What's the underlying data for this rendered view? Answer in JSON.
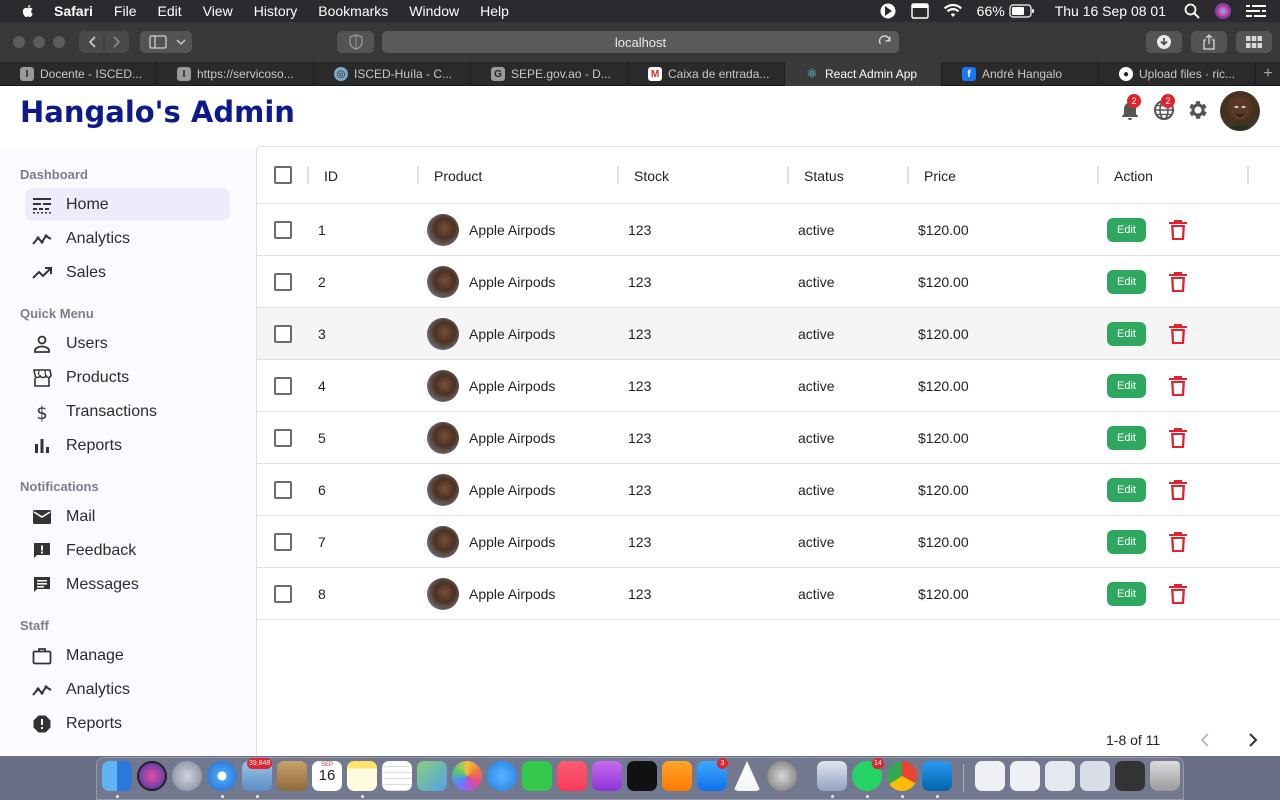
{
  "menubar": {
    "app_name": "Safari",
    "items": [
      "File",
      "Edit",
      "View",
      "History",
      "Bookmarks",
      "Window",
      "Help"
    ],
    "battery": "66%",
    "clock": "Thu 16 Sep  08 01"
  },
  "browser": {
    "url": "localhost",
    "tabs": [
      {
        "label": "Docente - ISCED...",
        "favicon": "I"
      },
      {
        "label": "https://servicoso...",
        "favicon": "I"
      },
      {
        "label": "ISCED-Huíla - C...",
        "favicon": "◎"
      },
      {
        "label": "SEPE.gov.ao - D...",
        "favicon": "G"
      },
      {
        "label": "Caixa de entrada...",
        "favicon": "M"
      },
      {
        "label": "React Admin App",
        "favicon": "⚛"
      },
      {
        "label": "André Hangalo",
        "favicon": "f"
      },
      {
        "label": "Upload files · ric...",
        "favicon": "●"
      }
    ],
    "active_tab": 5
  },
  "app": {
    "logo": "Hangalo's Admin",
    "notifications_count": "2",
    "language_count": "2"
  },
  "sidebar": {
    "sections": [
      {
        "title": "Dashboard",
        "items": [
          {
            "label": "Home",
            "icon": "line-style-icon",
            "active": true
          },
          {
            "label": "Analytics",
            "icon": "timeline-icon"
          },
          {
            "label": "Sales",
            "icon": "trending-up-icon"
          }
        ]
      },
      {
        "title": "Quick Menu",
        "items": [
          {
            "label": "Users",
            "icon": "person-outline-icon"
          },
          {
            "label": "Products",
            "icon": "storefront-icon"
          },
          {
            "label": "Transactions",
            "icon": "dollar-icon"
          },
          {
            "label": "Reports",
            "icon": "bar-chart-icon"
          }
        ]
      },
      {
        "title": "Notifications",
        "items": [
          {
            "label": "Mail",
            "icon": "mail-icon"
          },
          {
            "label": "Feedback",
            "icon": "feedback-icon"
          },
          {
            "label": "Messages",
            "icon": "chat-icon"
          }
        ]
      },
      {
        "title": "Staff",
        "items": [
          {
            "label": "Manage",
            "icon": "briefcase-icon"
          },
          {
            "label": "Analytics",
            "icon": "timeline-icon"
          },
          {
            "label": "Reports",
            "icon": "report-icon"
          }
        ]
      }
    ]
  },
  "table": {
    "columns": [
      "ID",
      "Product",
      "Stock",
      "Status",
      "Price",
      "Action"
    ],
    "edit_label": "Edit",
    "rows": [
      {
        "id": "1",
        "product": "Apple Airpods",
        "stock": "123",
        "status": "active",
        "price": "$120.00"
      },
      {
        "id": "2",
        "product": "Apple Airpods",
        "stock": "123",
        "status": "active",
        "price": "$120.00"
      },
      {
        "id": "3",
        "product": "Apple Airpods",
        "stock": "123",
        "status": "active",
        "price": "$120.00"
      },
      {
        "id": "4",
        "product": "Apple Airpods",
        "stock": "123",
        "status": "active",
        "price": "$120.00"
      },
      {
        "id": "5",
        "product": "Apple Airpods",
        "stock": "123",
        "status": "active",
        "price": "$120.00"
      },
      {
        "id": "6",
        "product": "Apple Airpods",
        "stock": "123",
        "status": "active",
        "price": "$120.00"
      },
      {
        "id": "7",
        "product": "Apple Airpods",
        "stock": "123",
        "status": "active",
        "price": "$120.00"
      },
      {
        "id": "8",
        "product": "Apple Airpods",
        "stock": "123",
        "status": "active",
        "price": "$120.00"
      }
    ],
    "pagination": "1-8 of 11"
  },
  "dock": {
    "badges": {
      "mail": "39,848",
      "app_store": "3",
      "whatsapp": "14"
    },
    "calendar_day": "16",
    "calendar_month": "SEP"
  },
  "colors": {
    "logo": "#0e1a8c",
    "edit_button": "#2fa85f",
    "delete_icon": "#e0242e",
    "active_nav": "#ececfb"
  }
}
